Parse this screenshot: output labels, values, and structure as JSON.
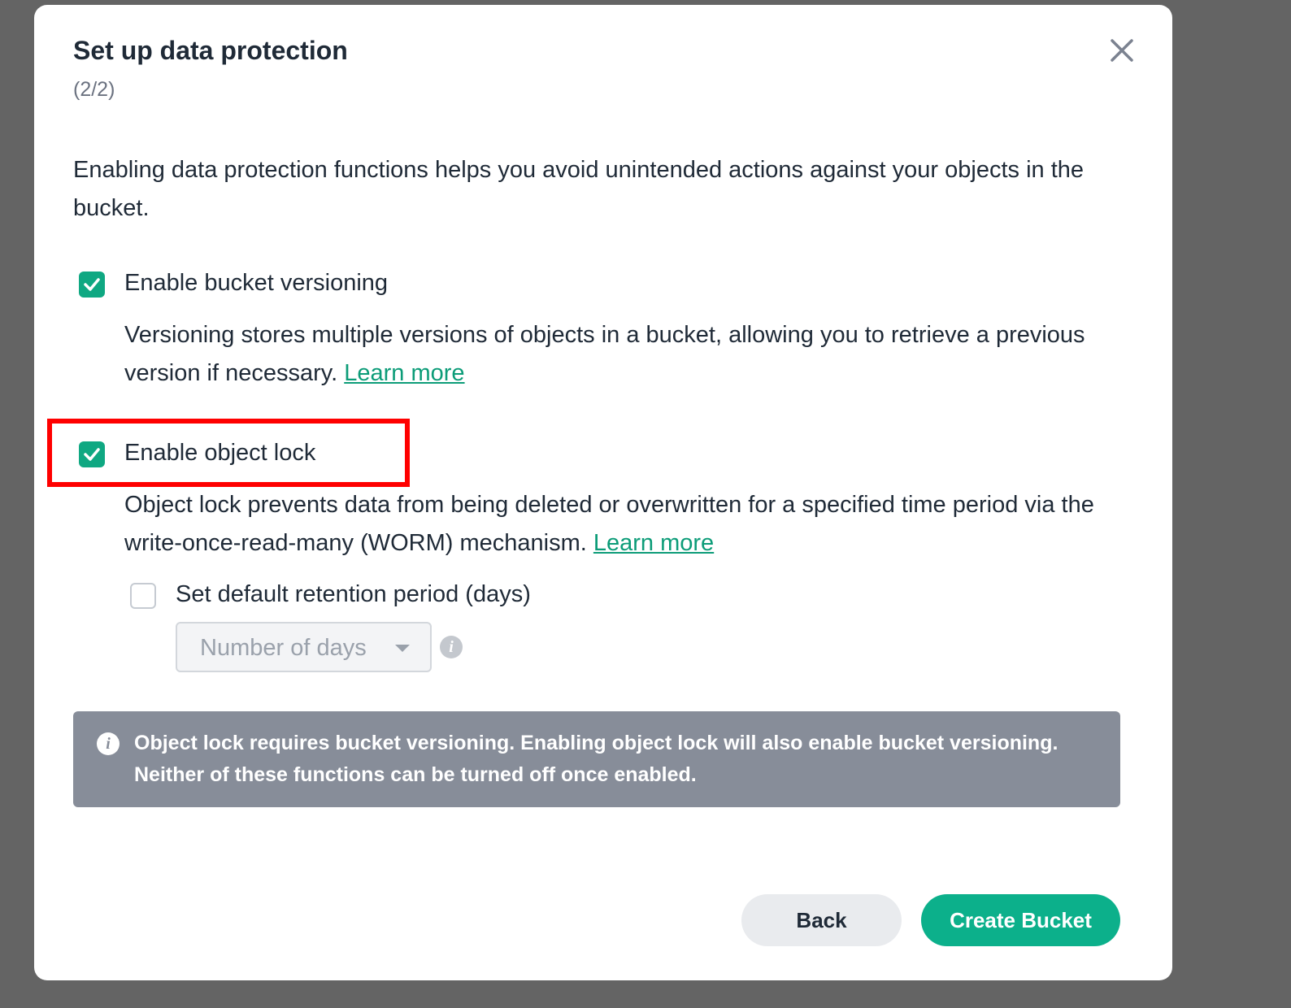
{
  "dialog": {
    "title": "Set up data protection",
    "step": "(2/2)",
    "close_icon": "close-icon",
    "intro": "Enabling data protection functions helps you avoid unintended actions against your objects in the bucket."
  },
  "versioning": {
    "label": "Enable bucket versioning",
    "checked": true,
    "description": "Versioning stores multiple versions of objects in a bucket, allowing you to retrieve a previous version if necessary.",
    "link": "Learn more"
  },
  "object_lock": {
    "label": "Enable object lock",
    "checked": true,
    "description": "Object lock prevents data from being deleted or overwritten for a specified time period via the write-once-read-many (WORM) mechanism.",
    "link": "Learn more"
  },
  "retention": {
    "label": "Set default retention period (days)",
    "checked": false,
    "select_placeholder": "Number of days",
    "info_icon": "info-icon"
  },
  "notice": {
    "icon": "info-icon",
    "text": "Object lock requires bucket versioning. Enabling object lock will also enable bucket versioning. Neither of these functions can be turned off once enabled."
  },
  "footer": {
    "back_label": "Back",
    "create_label": "Create Bucket"
  },
  "colors": {
    "accent": "#0cb08b",
    "link": "#0c9c78",
    "highlight": "#ff0000",
    "notice_bg": "#878d99"
  }
}
